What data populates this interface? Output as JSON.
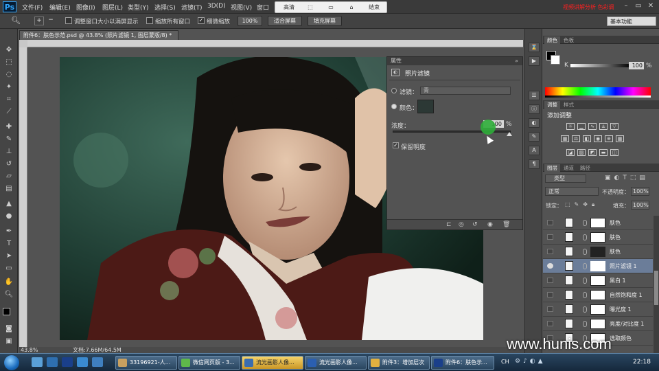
{
  "app": {
    "logo": "Ps"
  },
  "menu": [
    "文件(F)",
    "编辑(E)",
    "图像(I)",
    "图层(L)",
    "类型(Y)",
    "选择(S)",
    "滤镜(T)",
    "3D(D)",
    "视图(V)",
    "窗口"
  ],
  "recorder": {
    "buttons": [
      "高清",
      "",
      "",
      "",
      "结束"
    ]
  },
  "top_note": "视频讲解分析 色彩调",
  "options": {
    "chk1": "调整窗口大小以满屏显示",
    "chk2": "缩放所有窗口",
    "chk3": "细微缩放",
    "zoom_btn": "100%",
    "fit_btn": "适合屏幕",
    "fill_btn": "填充屏幕",
    "workspace": "基本功能"
  },
  "document": {
    "tab": "附件6：肤色示范.psd @ 43.8% (照片滤镜 1, 图层蒙版/8) *",
    "status_zoom": "43.8%",
    "status_doc": "文档:7.66M/64.5M"
  },
  "properties": {
    "header": "属性",
    "title": "照片滤镜",
    "filter_label": "滤镜：",
    "filter_value": "青",
    "color_label": "颜色：",
    "color_value": "#2c3835",
    "density_label": "浓度：",
    "density_value": "100",
    "density_unit": "%",
    "density_level": 1.0,
    "preserve_label": "保留明度"
  },
  "color_panel": {
    "tabs": [
      "颜色",
      "色板"
    ],
    "channel": "K",
    "value": "100",
    "unit": "%"
  },
  "adjust_panel": {
    "tabs": [
      "调整",
      "样式"
    ],
    "title": "添加调整"
  },
  "layers_panel": {
    "tabs": [
      "图层",
      "通道",
      "路径"
    ],
    "kind": "类型",
    "blend": "正常",
    "opacity_label": "不透明度：",
    "opacity_value": "100%",
    "lock_label": "锁定：",
    "fill_label": "填充：",
    "fill_value": "100%",
    "layers": [
      {
        "name": "肤色",
        "visible": false,
        "selected": false
      },
      {
        "name": "肤色",
        "visible": false,
        "selected": false
      },
      {
        "name": "肤色",
        "visible": false,
        "selected": false
      },
      {
        "name": "照片滤镜 1",
        "visible": true,
        "selected": true
      },
      {
        "name": "黑白 1",
        "visible": false,
        "selected": false
      },
      {
        "name": "自然饱和度 1",
        "visible": false,
        "selected": false
      },
      {
        "name": "曝光度 1",
        "visible": false,
        "selected": false
      },
      {
        "name": "亮度/对比度 1",
        "visible": false,
        "selected": false
      },
      {
        "name": "选取颜色",
        "visible": false,
        "selected": false
      }
    ]
  },
  "taskbar": {
    "buttons": [
      {
        "label": "33196921-人...",
        "active": false
      },
      {
        "label": "微信网页版 - 3...",
        "active": false
      },
      {
        "label": "流光画影人像...",
        "active": true
      },
      {
        "label": "流光画影人像...",
        "active": false
      },
      {
        "label": "附件3：增加层次",
        "active": false
      },
      {
        "label": "附件6：肤色示...",
        "active": false
      }
    ],
    "lang": "CH",
    "clock": "22:18"
  },
  "watermark": "www.hunis.com",
  "colors": {
    "accent": "#31a8ff",
    "selected_layer": "#6b7d99",
    "panel": "#535353"
  }
}
